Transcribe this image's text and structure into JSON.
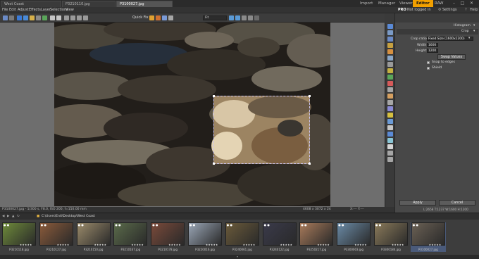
{
  "titlebar": {
    "tabs": [
      "West Coast",
      "P3210110.jpg",
      "P3100027.jpg"
    ],
    "modes": [
      "Import",
      "Manager",
      "Viewer",
      "Editor",
      "RAW"
    ],
    "active_mode": "Editor"
  },
  "menu": [
    "File",
    "Edit",
    "Adjust",
    "Effects",
    "Layer",
    "Selections",
    "View"
  ],
  "menu_right": {
    "pro": "PRO",
    "login": "Not logged in",
    "settings": "Settings",
    "help": "Help"
  },
  "toolbar": {
    "quick_fix": "Quick Fix",
    "zoom_mode": "Fit"
  },
  "panel": {
    "histogram": "Histogram",
    "crop": "Crop",
    "crop_ratio_label": "Crop ratio:",
    "crop_ratio_value": "Fixed Size (1600x1200)",
    "width_label": "Width:",
    "width_value": "1600",
    "height_label": "Height:",
    "height_value": "1200",
    "swap_label": "Swap Values",
    "snap_label": "Snap to edges",
    "shield_label": "Shield",
    "apply": "Apply",
    "cancel": "Cancel",
    "coords": "L:2658  T:1237  W:1600  H:1200"
  },
  "status": {
    "left": "P3100027.jpg - 1/300 s, F8.0, ISO 200, f=150.00 mm",
    "dims": "4608 x 3072 x 24",
    "xy": "X:---  Y:---"
  },
  "browser": {
    "path": "C:\\Users\\Enti\\Desktop\\West Coast",
    "thumbs": [
      {
        "name": "P3210118.jpg",
        "color": "#6e8a3a"
      },
      {
        "name": "P3210127.jpg",
        "color": "#8a5a3a"
      },
      {
        "name": "P3210150.jpg",
        "color": "#9a8a6a"
      },
      {
        "name": "P3210167.jpg",
        "color": "#5a6a4a"
      },
      {
        "name": "P3210178.jpg",
        "color": "#7a4a3a"
      },
      {
        "name": "P3220016.jpg",
        "color": "#9aa6b6"
      },
      {
        "name": "P3240061.jpg",
        "color": "#6a5a3a"
      },
      {
        "name": "P3240122.jpg",
        "color": "#3a3a4a"
      },
      {
        "name": "P3250217.jpg",
        "color": "#a87a5a"
      },
      {
        "name": "P3300003.jpg",
        "color": "#6a8aa6"
      },
      {
        "name": "P3300184.jpg",
        "color": "#8a7a5a"
      },
      {
        "name": "P3100027.jpg",
        "color": "#6a6054"
      }
    ]
  }
}
